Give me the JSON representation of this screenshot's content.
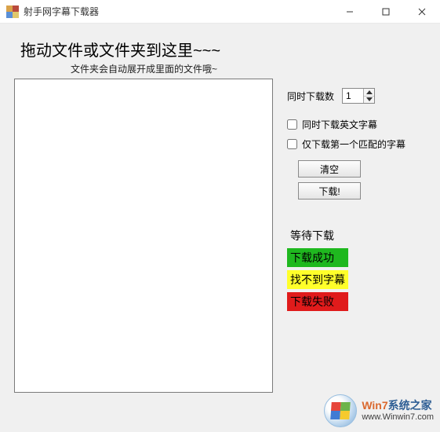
{
  "titlebar": {
    "title": "射手网字幕下载器"
  },
  "heading": "拖动文件或文件夹到这里~~~",
  "subheading": "文件夹会自动展开成里面的文件哦~",
  "concurrent": {
    "label": "同时下载数",
    "value": "1"
  },
  "checks": {
    "english_sub": "同时下载英文字幕",
    "first_match": "仅下载第一个匹配的字幕"
  },
  "buttons": {
    "clear": "清空",
    "download": "下载!"
  },
  "status": {
    "waiting": "等待下载",
    "success": "下载成功",
    "notfound": "找不到字幕",
    "failed": "下载失败"
  },
  "drop_items": [],
  "watermark": {
    "brand_prefix": "Win7",
    "brand_suffix": "系统之家",
    "url": "www.Winwin7.com"
  }
}
